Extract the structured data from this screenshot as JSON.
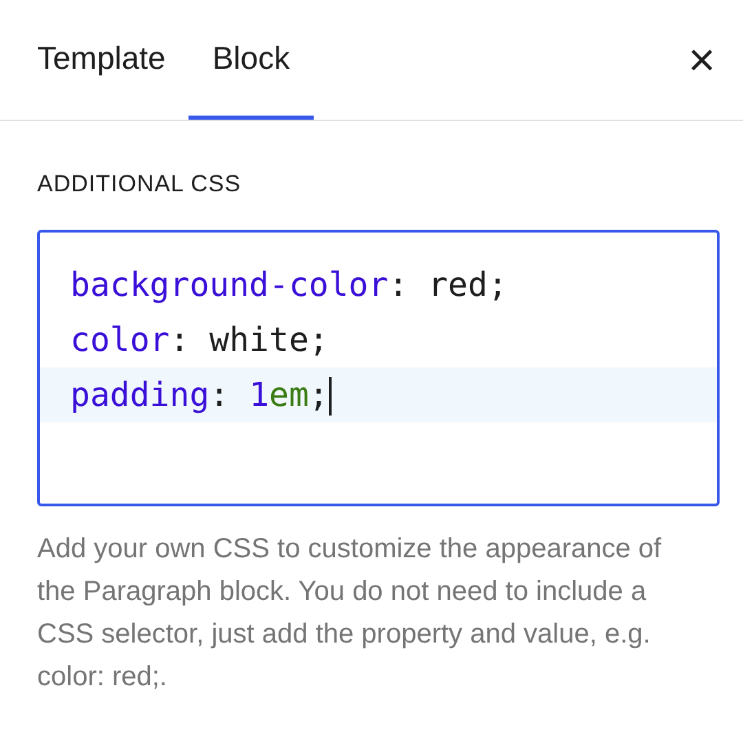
{
  "tabs": [
    {
      "label": "Template",
      "selected": false
    },
    {
      "label": "Block",
      "selected": true
    }
  ],
  "close": {
    "glyph": "×"
  },
  "section": {
    "heading": "ADDITIONAL CSS",
    "editor": {
      "lines": [
        {
          "active": false,
          "tokens": [
            {
              "text": "background-color",
              "kind": "property"
            },
            {
              "text": ": ",
              "kind": "plain"
            },
            {
              "text": "red;",
              "kind": "plain"
            }
          ]
        },
        {
          "active": false,
          "tokens": [
            {
              "text": "color",
              "kind": "property"
            },
            {
              "text": ": ",
              "kind": "plain"
            },
            {
              "text": "white;",
              "kind": "plain"
            }
          ]
        },
        {
          "active": true,
          "tokens": [
            {
              "text": "padding",
              "kind": "property"
            },
            {
              "text": ": ",
              "kind": "plain"
            },
            {
              "text": "1",
              "kind": "number"
            },
            {
              "text": "em",
              "kind": "unit"
            },
            {
              "text": ";",
              "kind": "plain"
            }
          ]
        }
      ]
    },
    "help": "Add your own CSS to customize the appearance of the Paragraph block. You do not need to include a CSS selector, just add the property and value, e.g. color: red;."
  }
}
